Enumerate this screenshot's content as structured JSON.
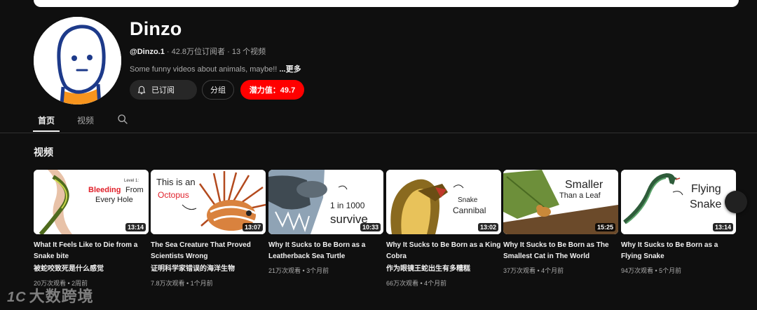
{
  "channel": {
    "name": "Dinzo",
    "handle": "@Dinzo.1",
    "subscribers": "42.8万位订阅者",
    "video_count": "13 个视频",
    "separator": " · ",
    "description": "Some funny videos about animals, maybe!! ",
    "more_label": "...更多"
  },
  "buttons": {
    "subscribed": "已订阅",
    "group": "分组",
    "potential": "潜力值：49.7"
  },
  "tabs": [
    {
      "label": "首页",
      "active": true
    },
    {
      "label": "视频",
      "active": false
    }
  ],
  "section_title": "视频",
  "videos": [
    {
      "title": "What It Feels Like to Die from a Snake bite",
      "subtitle": "被蛇咬致死是什么感觉",
      "stats": "20万次观看 • 2周前",
      "duration": "13:14",
      "thumb": {
        "level": "Level 1:",
        "line1": "Bleeding",
        "line1b": "From",
        "line2": "Every Hole"
      }
    },
    {
      "title": "The Sea Creature That Proved Scientists Wrong",
      "subtitle": "证明科学家错误的海洋生物",
      "stats": "7.8万次观看 • 1个月前",
      "duration": "13:07",
      "thumb": {
        "line1": "This is an",
        "line2": "Octopus"
      }
    },
    {
      "title": "Why It Sucks to Be Born as a Leatherback Sea Turtle",
      "subtitle": "",
      "stats": "21万次观看 • 3个月前",
      "duration": "10:33",
      "thumb": {
        "line1": "1 in 1000",
        "line2": "survive"
      }
    },
    {
      "title": "Why It Sucks to Be Born as a King Cobra",
      "subtitle": "作为眼镜王蛇出生有多糟糕",
      "stats": "66万次观看 • 4个月前",
      "duration": "13:02",
      "thumb": {
        "line1": "Snake",
        "line2": "Cannibal"
      }
    },
    {
      "title": "Why It Sucks to Be Born as The Smallest Cat in The World",
      "subtitle": "",
      "stats": "37万次观看 • 4个月前",
      "duration": "15:25",
      "thumb": {
        "line1": "Smaller",
        "line2": "Than a Leaf"
      }
    },
    {
      "title": "Why It Sucks to Be Born as a Flying Snake",
      "subtitle": "",
      "stats": "94万次观看 • 5个月前",
      "duration": "13:14",
      "thumb": {
        "line1": "Flying",
        "line2": "Snake"
      }
    }
  ],
  "watermark": {
    "logo": "1C",
    "text": "大数跨境"
  },
  "colors": {
    "background": "#0f0f0f",
    "potential_button": "#ff0000",
    "avatar_shirt": "#f7941d",
    "avatar_line": "#1d3a8a"
  }
}
